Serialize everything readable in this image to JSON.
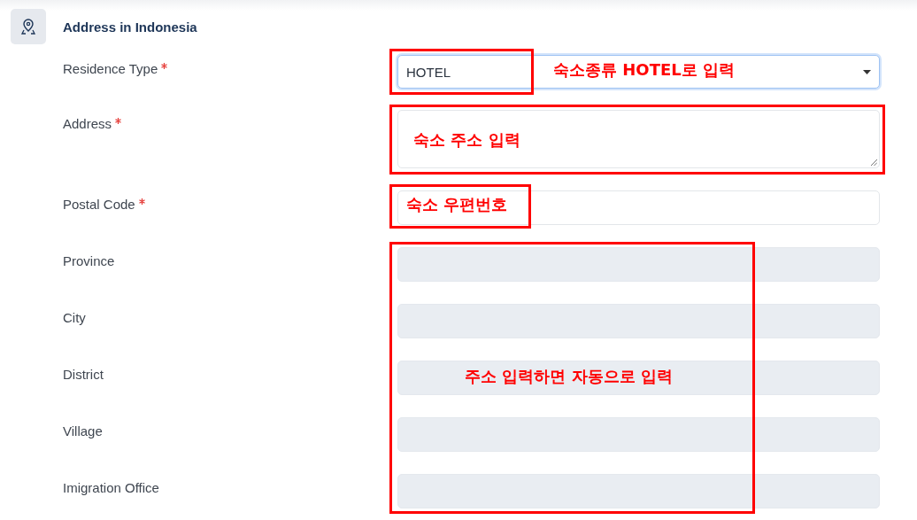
{
  "section": {
    "title": "Address in Indonesia",
    "fields": [
      {
        "label": "Residence Type",
        "required": true,
        "kind": "select",
        "value": "HOTEL",
        "focused": true
      },
      {
        "label": "Address",
        "required": true,
        "kind": "textarea"
      },
      {
        "label": "Postal Code",
        "required": true,
        "kind": "input"
      },
      {
        "label": "Province",
        "required": false,
        "kind": "readonly"
      },
      {
        "label": "City",
        "required": false,
        "kind": "readonly"
      },
      {
        "label": "District",
        "required": false,
        "kind": "readonly"
      },
      {
        "label": "Village",
        "required": false,
        "kind": "readonly"
      },
      {
        "label": "Imigration Office",
        "required": false,
        "kind": "readonly"
      }
    ]
  },
  "annotations": [
    {
      "text": "숙소종류 HOTEL로 입력"
    },
    {
      "text": "숙소 주소 입력"
    },
    {
      "text": "숙소 우편번호"
    },
    {
      "text": "주소 입력하면 자동으로 입력"
    }
  ]
}
